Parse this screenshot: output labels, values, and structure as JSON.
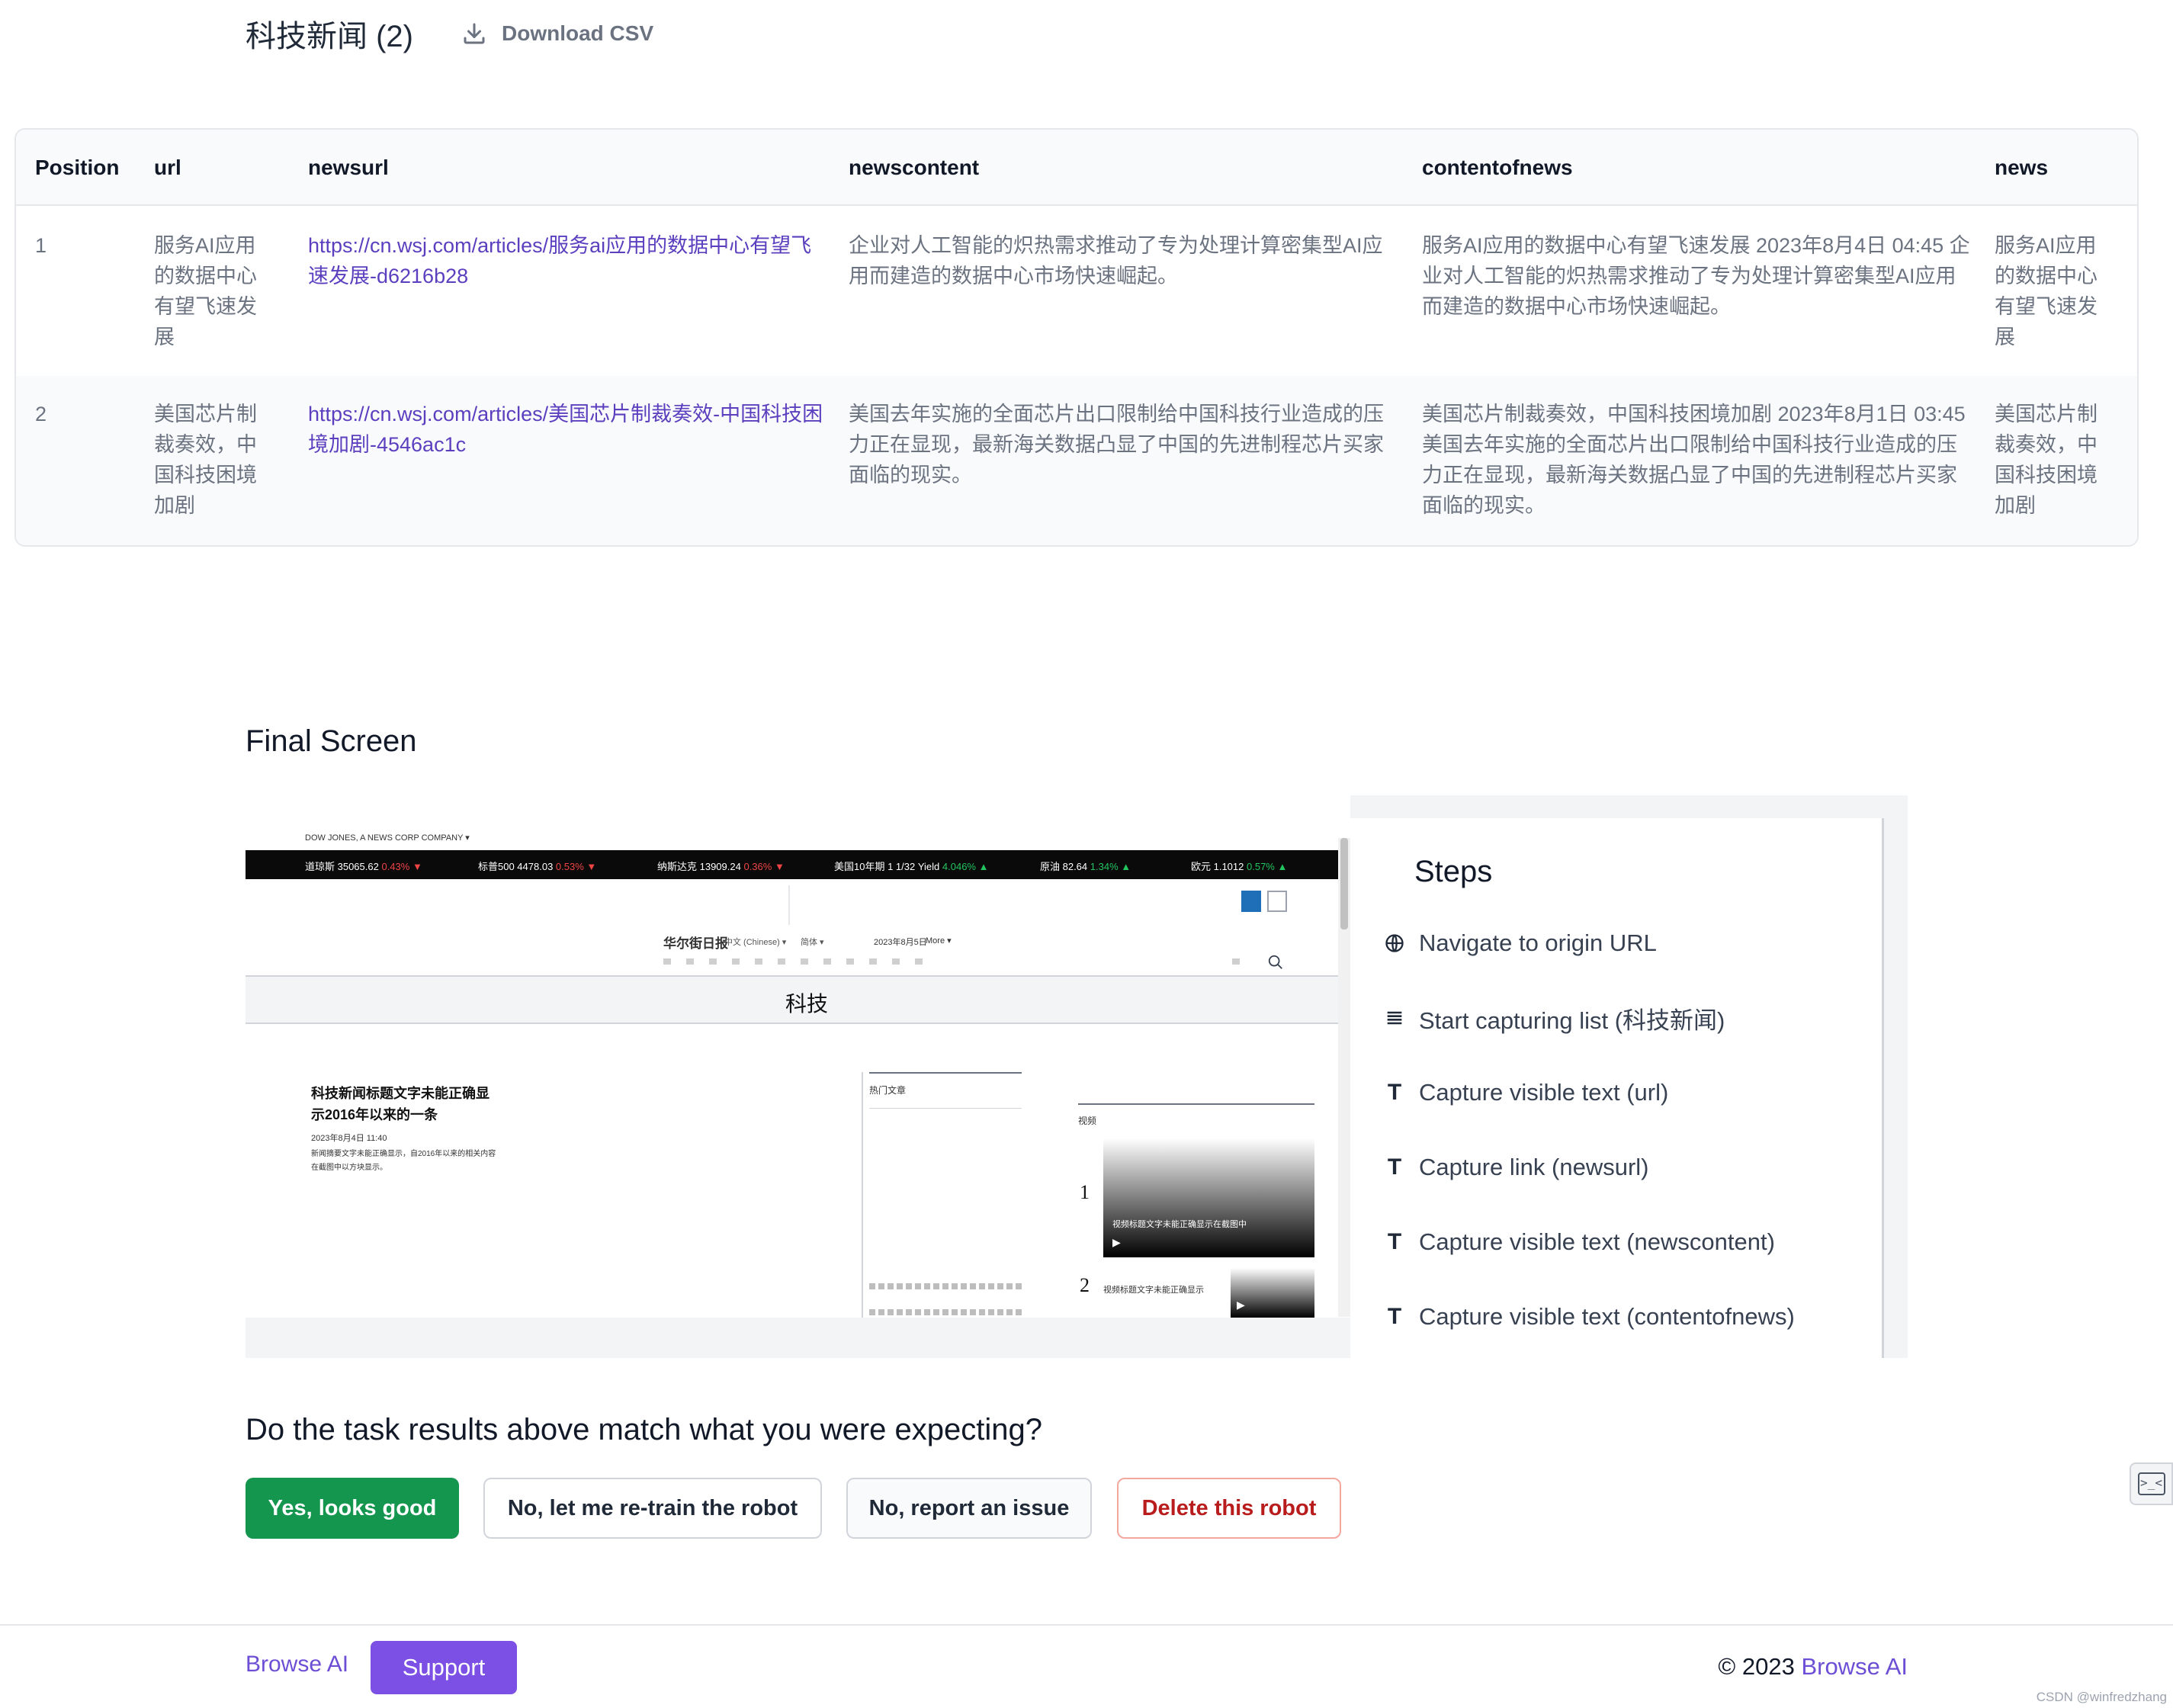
{
  "list": {
    "title": "科技新闻 (2)",
    "download_label": "Download CSV"
  },
  "table": {
    "columns": [
      "Position",
      "url",
      "newsurl",
      "newscontent",
      "contentofnews",
      "news"
    ],
    "rows": [
      {
        "position": "1",
        "url": "服务AI应用的数据中心有望飞速发展",
        "newsurl": "https://cn.wsj.com/articles/服务ai应用的数据中心有望飞速发展-d6216b28",
        "newscontent": "企业对人工智能的炽热需求推动了专为处理计算密集型AI应用而建造的数据中心市场快速崛起。",
        "contentofnews": "服务AI应用的数据中心有望飞速发展 2023年8月4日 04:45 企业对人工智能的炽热需求推动了专为处理计算密集型AI应用而建造的数据中心市场快速崛起。",
        "news": "服务AI应用的数据中心有望飞速发展"
      },
      {
        "position": "2",
        "url": "美国芯片制裁奏效，中国科技困境加剧",
        "newsurl": "https://cn.wsj.com/articles/美国芯片制裁奏效-中国科技困境加剧-4546ac1c",
        "newscontent": "美国去年实施的全面芯片出口限制给中国科技行业造成的压力正在显现，最新海关数据凸显了中国的先进制程芯片买家面临的现实。",
        "contentofnews": "美国芯片制裁奏效，中国科技困境加剧 2023年8月1日 03:45 美国去年实施的全面芯片出口限制给中国科技行业造成的压力正在显现，最新海关数据凸显了中国的先进制程芯片买家面临的现实。",
        "news": "美国芯片制裁奏效，中国科技困境加剧"
      }
    ]
  },
  "final_screen": {
    "title": "Final Screen",
    "screenshot": {
      "corp_bar": "DOW JONES, A NEWS CORP COMPANY ▾",
      "ticker": [
        {
          "label": "道琼斯 35065.62",
          "change": "0.43% ▼",
          "dir": "dn"
        },
        {
          "label": "标普500 4478.03",
          "change": "0.53% ▼",
          "dir": "dn"
        },
        {
          "label": "纳斯达克 13909.24",
          "change": "0.36% ▼",
          "dir": "dn"
        },
        {
          "label": "美国10年期 1 1/32 Yield",
          "change": "4.046% ▲",
          "dir": "up"
        },
        {
          "label": "原油 82.64",
          "change": "1.34% ▲",
          "dir": "up"
        },
        {
          "label": "欧元 1.1012",
          "change": "0.57% ▲",
          "dir": "up"
        }
      ],
      "masthead": "华尔街日报",
      "lang": "中文 (Chinese) ▾",
      "edition": "简体 ▾",
      "date": "2023年8月5日",
      "more": "More ▾",
      "section_label": "科技",
      "headline": "科技新闻标题文字未能正确显示2016年以来的一条",
      "headline_date": "2023年8月4日 11:40",
      "summary": "新闻摘要文字未能正确显示，自2016年以来的相关内容在截图中以方块显示。",
      "popular_label": "热门文章",
      "video_label": "视频",
      "video_rank_1": "1",
      "video_rank_2": "2",
      "video_caption_1": "视频标题文字未能正确显示在截图中",
      "video_caption_2": "视频标题文字未能正确显示"
    },
    "steps_title": "Steps",
    "steps": [
      {
        "icon": "globe-icon",
        "label": "Navigate to origin URL"
      },
      {
        "icon": "list-icon",
        "label": "Start capturing list (科技新闻)"
      },
      {
        "icon": "text-icon",
        "label": "Capture visible text (url)"
      },
      {
        "icon": "text-icon",
        "label": "Capture link (newsurl)"
      },
      {
        "icon": "text-icon",
        "label": "Capture visible text (newscontent)"
      },
      {
        "icon": "text-icon",
        "label": "Capture visible text (contentofnews)"
      }
    ]
  },
  "feedback": {
    "question": "Do the task results above match what you were expecting?",
    "yes_label": "Yes, looks good",
    "retrain_label": "No, let me re-train the robot",
    "report_label": "No, report an issue",
    "delete_label": "Delete this robot"
  },
  "footer": {
    "brand": "Browse AI",
    "support_label": "Support",
    "copyright_prefix": "© 2023 ",
    "copyright_brand": "Browse AI",
    "watermark": "CSDN @winfredzhang"
  },
  "colors": {
    "accent_purple": "#7c50e4",
    "link_purple": "#5b3fbf",
    "success_green": "#15964f",
    "danger_red": "#b91c1c"
  }
}
